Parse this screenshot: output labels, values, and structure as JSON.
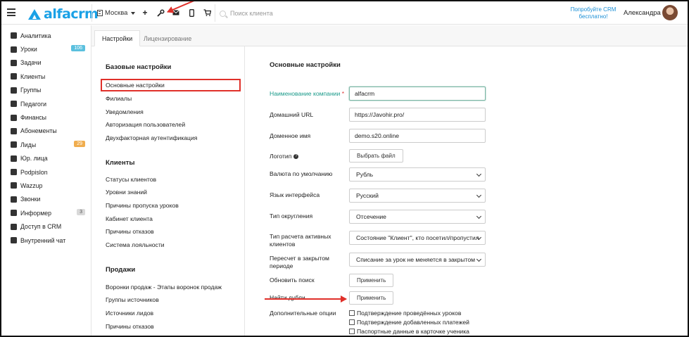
{
  "app": {
    "logo_text": "alfacrm",
    "city": "Москва",
    "search_placeholder": "Поиск клиента",
    "promo": "Попробуйте CRM бесплатно!",
    "user_name": "Александра"
  },
  "sidebar": {
    "items": [
      {
        "label": "Аналитика",
        "icon": "chart-icon"
      },
      {
        "label": "Уроки",
        "icon": "calendar-icon",
        "badge": "106",
        "badge_color": "#5bc0de"
      },
      {
        "label": "Задачи",
        "icon": "tasks-icon"
      },
      {
        "label": "Клиенты",
        "icon": "user-icon"
      },
      {
        "label": "Группы",
        "icon": "users-icon"
      },
      {
        "label": "Педагоги",
        "icon": "graduation-icon"
      },
      {
        "label": "Финансы",
        "icon": "money-icon"
      },
      {
        "label": "Абонементы",
        "icon": "tag-icon"
      },
      {
        "label": "Лиды",
        "icon": "user-plus-icon",
        "badge": "29",
        "badge_color": "#f0ad4e"
      },
      {
        "label": "Юр. лица",
        "icon": "building-icon"
      },
      {
        "label": "Podpislon",
        "icon": "file-icon"
      },
      {
        "label": "Wazzup",
        "icon": "whatsapp-icon"
      },
      {
        "label": "Звонки",
        "icon": "phone-icon"
      },
      {
        "label": "Информер",
        "icon": "envelope-icon",
        "badge": "3",
        "badge_color": "#d9d9d9"
      },
      {
        "label": "Доступ в CRM",
        "icon": "lock-icon"
      },
      {
        "label": "Внутренний чат",
        "icon": "chat-icon"
      }
    ]
  },
  "tabs": [
    {
      "label": "Настройки",
      "active": true
    },
    {
      "label": "Лицензирование",
      "active": false
    }
  ],
  "nav": {
    "section1": "Базовые настройки",
    "section1_items": [
      "Основные настройки",
      "Филиалы",
      "Уведомления",
      "Авторизация пользователей",
      "Двухфакторная аутентификация"
    ],
    "section2": "Клиенты",
    "section2_items": [
      "Статусы клиентов",
      "Уровни знаний",
      "Причины пропуска уроков",
      "Кабинет клиента",
      "Причины отказов",
      "Система лояльности"
    ],
    "section3": "Продажи",
    "section3_items": [
      "Воронки продаж - Этапы воронок продаж",
      "Группы источников",
      "Источники лидов",
      "Причины отказов"
    ]
  },
  "form": {
    "title": "Основные настройки",
    "company_label": "Наименование компании",
    "company_required": "*",
    "company_value": "alfacrm",
    "home_url_label": "Домашний URL",
    "home_url_value": "https://Javohir.pro/",
    "domain_label": "Доменное имя",
    "domain_value": "demo.s20.online",
    "logo_label": "Логотип",
    "logo_button": "Выбрать файл",
    "currency_label": "Валюта по умолчанию",
    "currency_value": "Рубль",
    "lang_label": "Язык интерфейса",
    "lang_value": "Русский",
    "rounding_label": "Тип округления",
    "rounding_value": "Отсечение",
    "active_calc_label": "Тип расчета активных клиентов",
    "active_calc_value": "Состояние \"Клиент\", кто посетил/пропустил",
    "recalc_label": "Пересчет в закрытом периоде",
    "recalc_value": "Списание за урок не меняется в закрытом",
    "update_search_label": "Обновить поиск",
    "apply_button": "Применить",
    "find_dupes_label": "Найти дубли",
    "extra_options_label": "Дополнительные опции",
    "options": [
      "Подтверждение проведённых уроков",
      "Подтверждение добавленных платежей",
      "Паспортные данные в карточке ученика"
    ]
  },
  "colors": {
    "brand": "#1aa1e6",
    "annotation_red": "#e0302a",
    "required_label": "#1a9a8a"
  }
}
